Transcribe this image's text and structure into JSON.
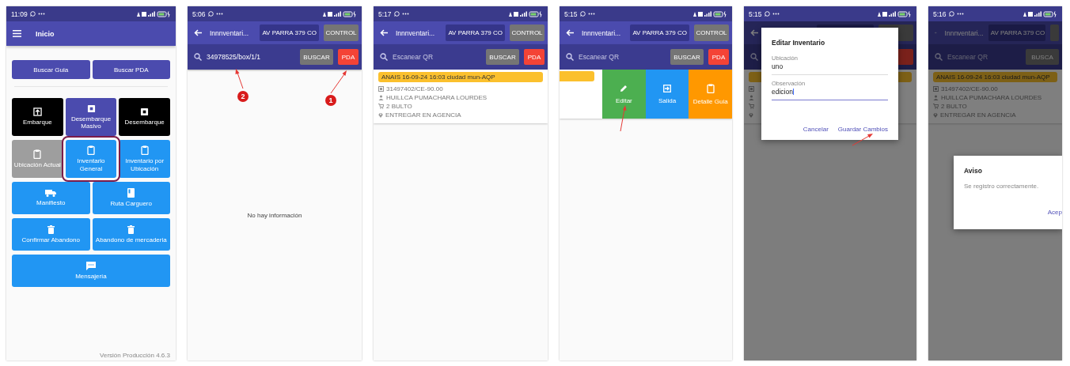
{
  "screens": [
    {
      "kind": "home",
      "time": "11:09",
      "title": "Inicio",
      "top_buttons": [
        "Buscar Guia",
        "Buscar PDA"
      ],
      "tile_rows": [
        [
          {
            "label": "Embarque",
            "color": "#000000",
            "highlighted": false
          },
          {
            "label": "Desembarque Masivo",
            "color": "#4b4bae",
            "highlighted": false
          },
          {
            "label": "Desembarque",
            "color": "#000000",
            "highlighted": false
          }
        ],
        [
          {
            "label": "Ubicación Actual",
            "color": "#9e9e9e",
            "highlighted": false
          },
          {
            "label": "Inventario General",
            "color": "#2196f3",
            "highlighted": true
          },
          {
            "label": "Inventario por Ubicación",
            "color": "#2196f3",
            "highlighted": false
          }
        ],
        [
          {
            "label": "Manifiesto",
            "color": "#2196f3",
            "highlighted": false
          },
          {
            "label": "Ruta Carguero",
            "color": "#2196f3",
            "highlighted": false
          }
        ],
        [
          {
            "label": "Confirmar Abandono",
            "color": "#2196f3",
            "highlighted": false
          },
          {
            "label": "Abandono de mercaderia",
            "color": "#2196f3",
            "highlighted": false
          }
        ],
        [
          {
            "label": "Mensajería",
            "color": "#2196f3",
            "highlighted": false
          }
        ]
      ],
      "version": "Versión Producción 4.6.3"
    },
    {
      "kind": "search",
      "time": "5:06",
      "title": "Innnventari...",
      "store": "AV PARRA 379 CO",
      "control": "CONTROL",
      "query": "34978525/box/1/1",
      "search_button": "BUSCAR",
      "pda_button": "PDA",
      "empty_text": "No hay información",
      "markers": [
        "2",
        "1"
      ]
    },
    {
      "kind": "result",
      "time": "5:17",
      "title": "Innnventari...",
      "store": "AV PARRA 379 CO",
      "control": "CONTROL",
      "placeholder": "Escanear QR",
      "search_button": "BUSCAR",
      "pda_button": "PDA",
      "card": {
        "header": "ANAIS  16-09-24 16:03 ciudad mun-AQP",
        "lines": [
          "31497402/CE-90.00",
          "HUILLCA PUMACHARA LOURDES",
          "2 BULTO",
          "ENTREGAR EN AGENCIA"
        ]
      }
    },
    {
      "kind": "swipe",
      "time": "5:15",
      "title": "Innnventari...",
      "store": "AV PARRA 379 CO",
      "control": "CONTROL",
      "placeholder": "Escanear QR",
      "search_button": "BUSCAR",
      "pda_button": "PDA",
      "actions": [
        {
          "label": "Editar",
          "color": "#4caf50"
        },
        {
          "label": "Salida",
          "color": "#2196f3"
        },
        {
          "label": "Detalle Guia",
          "color": "#ff9800"
        }
      ]
    },
    {
      "kind": "edit",
      "time": "5:15",
      "dialog": {
        "title": "Editar Inventario",
        "fields": [
          {
            "label": "Ubicación",
            "value": "uno",
            "focused": false
          },
          {
            "label": "Observación",
            "value": "edicion",
            "focused": true
          }
        ],
        "buttons": [
          "Cancelar",
          "Guardar Cambios"
        ]
      }
    },
    {
      "kind": "alert",
      "time": "5:16",
      "title": "Innnventari...",
      "store": "AV PARRA 379 CO",
      "placeholder": "Escanear QR",
      "search_button": "BUSCA",
      "card": {
        "header": "ANAIS  16-09-24 16:03 ciudad mun-AQP",
        "lines": [
          "31497402/CE-90.00",
          "HUILLCA PUMACHARA LOURDES",
          "2 BULTO",
          "ENTREGAR EN AGENCIA"
        ]
      },
      "dialog": {
        "title": "Aviso",
        "message": "Se registro correctamente.",
        "button": "Acep"
      }
    }
  ]
}
